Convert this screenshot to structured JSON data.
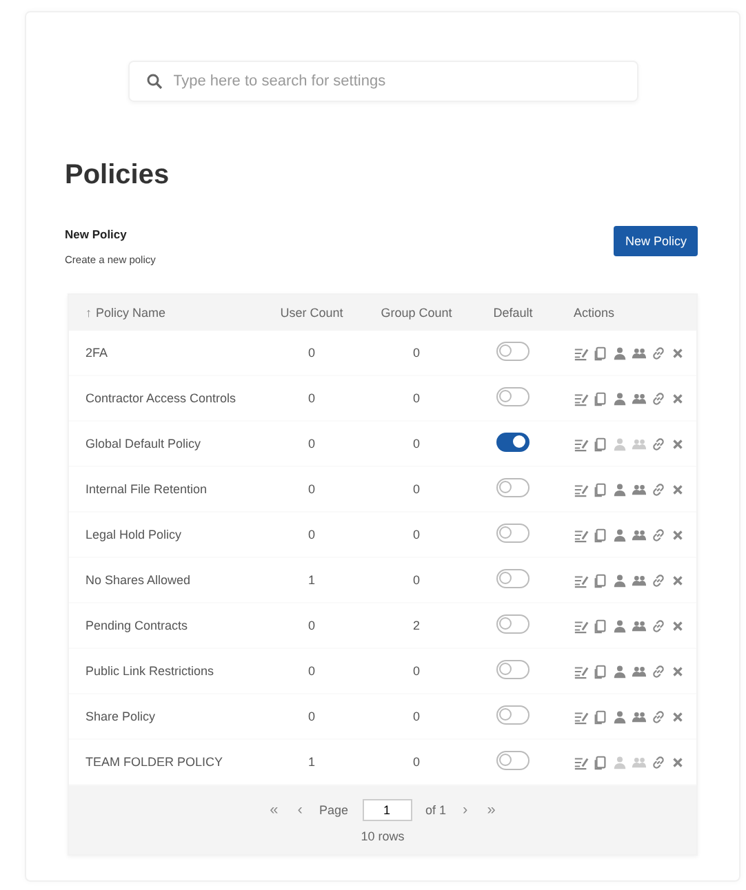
{
  "search": {
    "placeholder": "Type here to search for settings"
  },
  "title": "Policies",
  "new_policy": {
    "heading": "New Policy",
    "description": "Create a new policy",
    "button": "New Policy"
  },
  "table": {
    "columns": [
      {
        "label": "Policy Name",
        "sort_indicator": "↑"
      },
      {
        "label": "User Count"
      },
      {
        "label": "Group Count"
      },
      {
        "label": "Default"
      },
      {
        "label": "Actions"
      }
    ],
    "rows": [
      {
        "name": "2FA",
        "user_count": "0",
        "group_count": "0",
        "default": false,
        "restricted": false
      },
      {
        "name": "Contractor Access Controls",
        "user_count": "0",
        "group_count": "0",
        "default": false,
        "restricted": false
      },
      {
        "name": "Global Default Policy",
        "user_count": "0",
        "group_count": "0",
        "default": true,
        "restricted": true
      },
      {
        "name": "Internal File Retention",
        "user_count": "0",
        "group_count": "0",
        "default": false,
        "restricted": false
      },
      {
        "name": "Legal Hold Policy",
        "user_count": "0",
        "group_count": "0",
        "default": false,
        "restricted": false
      },
      {
        "name": "No Shares Allowed",
        "user_count": "1",
        "group_count": "0",
        "default": false,
        "restricted": false
      },
      {
        "name": "Pending Contracts",
        "user_count": "0",
        "group_count": "2",
        "default": false,
        "restricted": false
      },
      {
        "name": "Public Link Restrictions",
        "user_count": "0",
        "group_count": "0",
        "default": false,
        "restricted": false
      },
      {
        "name": "Share Policy",
        "user_count": "0",
        "group_count": "0",
        "default": false,
        "restricted": false
      },
      {
        "name": "TEAM FOLDER POLICY",
        "user_count": "1",
        "group_count": "0",
        "default": false,
        "restricted": true
      }
    ]
  },
  "pagination": {
    "first": "«",
    "previous": "‹",
    "page_label": "Page",
    "page": "1",
    "of": "of 1",
    "next": "›",
    "last": "»",
    "row_count": "10 rows"
  }
}
